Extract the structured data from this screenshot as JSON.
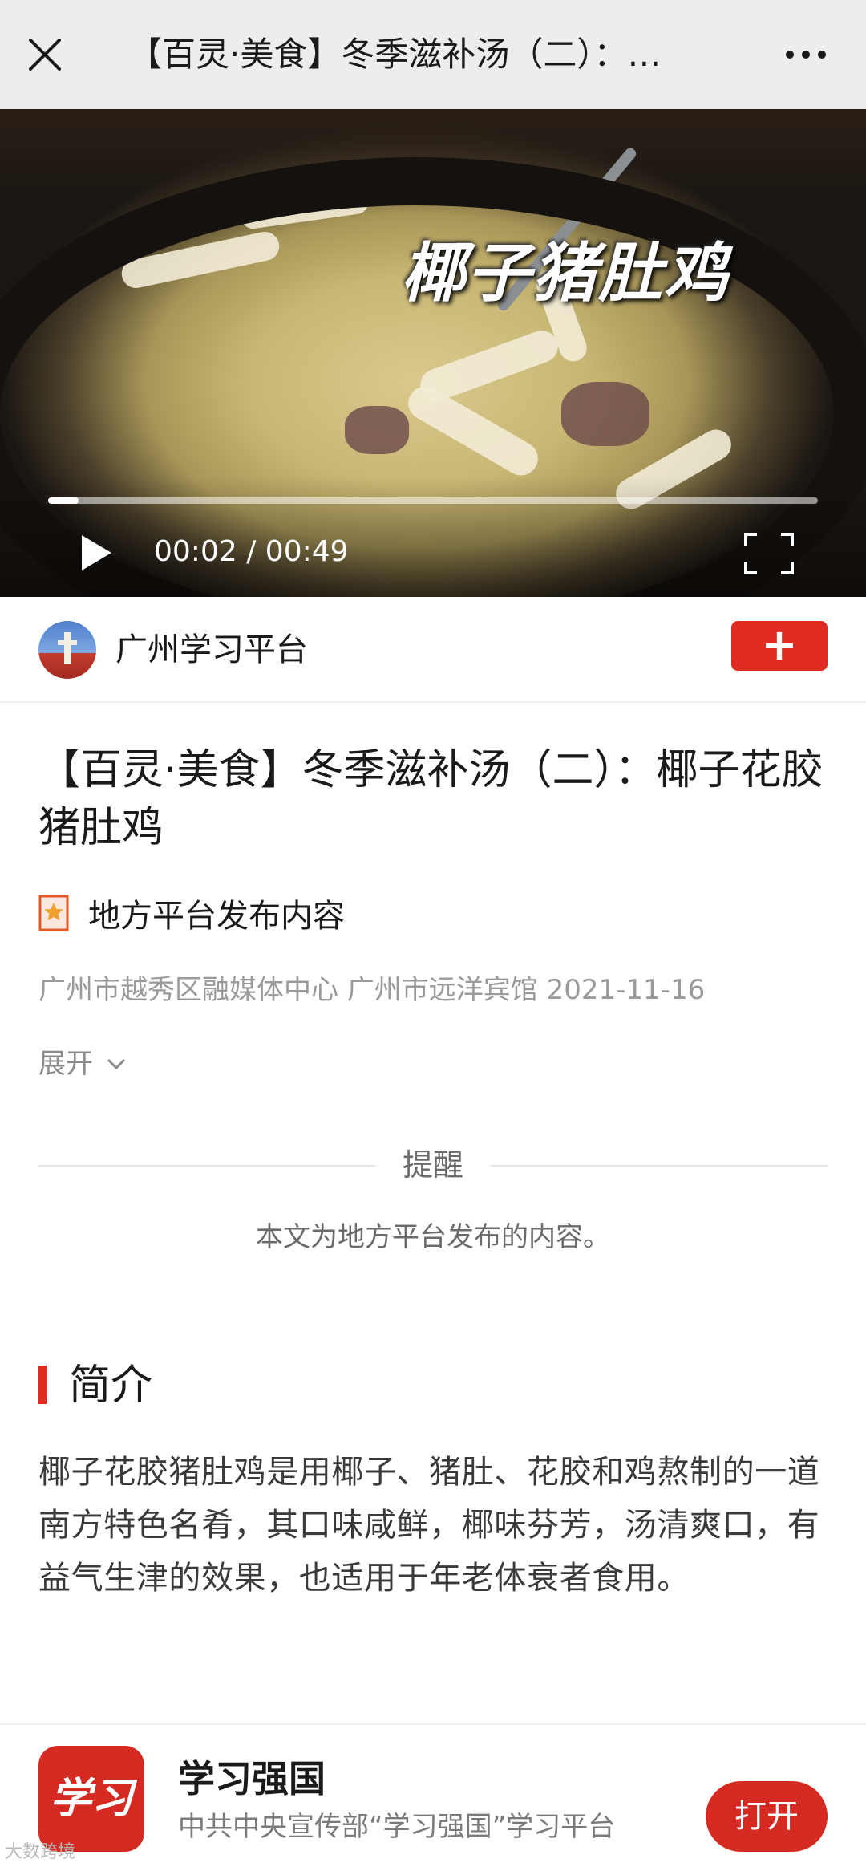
{
  "topbar": {
    "title": "【百灵·美食】冬季滋补汤（二）：…",
    "close_icon": "close-icon",
    "more_icon": "more-icon"
  },
  "video": {
    "caption": "椰子猪肚鸡",
    "time_current": "00:02",
    "time_separator": "/",
    "time_total": "00:49",
    "progress": 0.04
  },
  "account": {
    "name": "广州学习平台",
    "follow_label": "+"
  },
  "article": {
    "title": "【百灵·美食】冬季滋补汤（二）：椰子花胶猪肚鸡",
    "tag_text": "地方平台发布内容",
    "meta": "广州市越秀区融媒体中心 广州市远洋宾馆 2021-11-16",
    "expand_label": "展开"
  },
  "notice": {
    "title": "提醒",
    "body": "本文为地方平台发布的内容。"
  },
  "intro": {
    "heading": "简介",
    "text": "椰子花胶猪肚鸡是用椰子、猪肚、花胶和鸡熬制的一道南方特色名肴，其口味咸鲜，椰味芬芳，汤清爽口，有益气生津的效果，也适用于年老体衰者食用。"
  },
  "banner": {
    "logo_text": "学习",
    "app_name": "学习强国",
    "app_desc": "中共中央宣传部“学习强国”学习平台",
    "open_label": "打开"
  },
  "watermark": "大数跨境",
  "colors": {
    "accent_red": "#e02b23",
    "topbar_bg": "#ededed",
    "meta_gray": "#9a9a9a"
  }
}
